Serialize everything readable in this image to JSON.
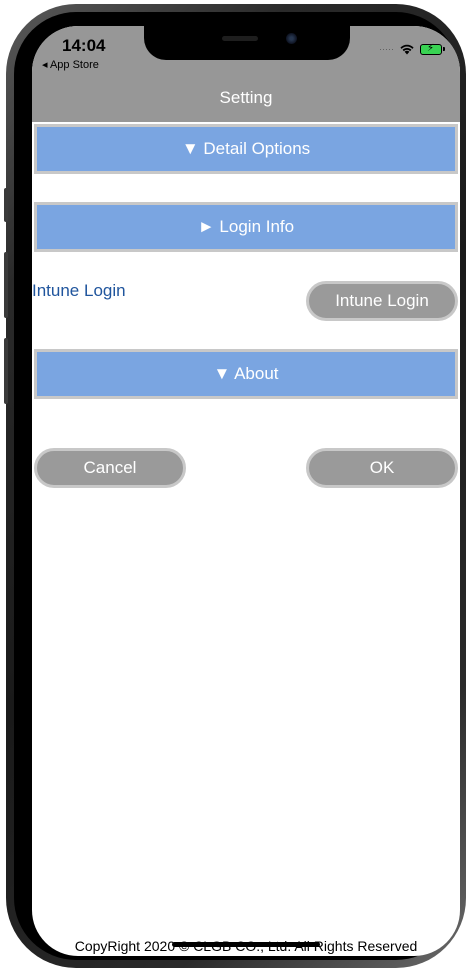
{
  "status_bar": {
    "time": "14:04",
    "back_app": "◂ App Store",
    "signal": "·····"
  },
  "nav": {
    "title": "Setting"
  },
  "sections": {
    "detail_options": "▼ Detail Options",
    "login_info": "► Login Info",
    "about": "▼ About"
  },
  "login": {
    "link_label": "Intune Login",
    "button_label": "Intune Login"
  },
  "actions": {
    "cancel_label": "Cancel",
    "ok_label": "OK"
  },
  "footer": {
    "copyright": "CopyRight 2020 © CLGB CO., Ltd. All Rights Reserved"
  },
  "colors": {
    "section_bar": "#7aa5e1",
    "header_bg": "#979797",
    "link": "#20559d",
    "button_bg": "#9a9a9a"
  }
}
